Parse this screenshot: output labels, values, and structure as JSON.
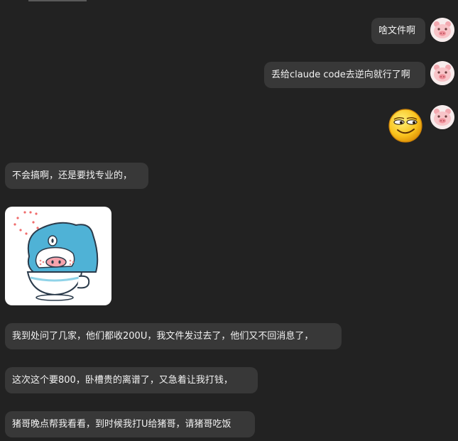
{
  "messages": {
    "m1": "啥文件啊",
    "m2": "丢给claude code去逆向就行了啊",
    "m3": "不会搞啊，还是要找专业的，",
    "m4": "我到处问了几家，他们都收200U，我文件发过去了，他们又不回消息了，",
    "m5": "这次这个要800，卧槽贵的离谱了，又急着让我打钱，",
    "m6": "猪哥晚点帮我看看，到时候我打U给猪哥，请猪哥吃饭"
  },
  "colors": {
    "background": "#222222",
    "bubble": "#383838",
    "text": "#f2f2f2"
  },
  "icons": {
    "self_avatar": "pig-avatar-icon",
    "emoji": "smirk-emoji-icon",
    "sticker": "blue-shark-teacup-sticker"
  }
}
